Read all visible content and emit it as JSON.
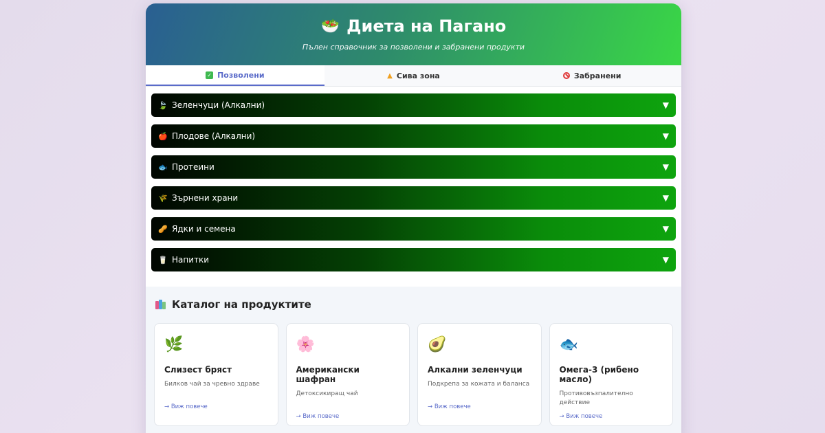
{
  "header": {
    "icon": "salad-bowl-icon",
    "title": "Диета на Пагано",
    "subtitle": "Пълен справочник за позволени и забранени продукти"
  },
  "tabs": [
    {
      "label": "Позволени",
      "icon": "checkmark-icon",
      "active": true
    },
    {
      "label": "Сива зона",
      "icon": "warning-icon",
      "active": false
    },
    {
      "label": "Забранени",
      "icon": "ban-icon",
      "active": false
    }
  ],
  "accordion": [
    {
      "label": "Зеленчуци (Алкални)",
      "icon": "leaf-icon"
    },
    {
      "label": "Плодове (Алкални)",
      "icon": "apple-icon"
    },
    {
      "label": "Протеини",
      "icon": "fish-icon"
    },
    {
      "label": "Зърнени храни",
      "icon": "grain-icon"
    },
    {
      "label": "Ядки и семена",
      "icon": "peanut-icon"
    },
    {
      "label": "Напитки",
      "icon": "cup-icon"
    }
  ],
  "catalog": {
    "title": "Каталог на продуктите",
    "icon": "books-icon",
    "products": [
      {
        "name": "Слизест бряст",
        "desc": "Билков чай за чревно здраве",
        "link": "→ Виж повече",
        "icon": "herb-icon"
      },
      {
        "name": "Американски шафран",
        "desc": "Детоксикиращ чай",
        "link": "→ Виж повече",
        "icon": "flower-icon"
      },
      {
        "name": "Алкални зеленчуци",
        "desc": "Подкрепа за кожата и баланса",
        "link": "→ Виж повече",
        "icon": "avocado-icon"
      },
      {
        "name": "Омега-3 (рибено масло)",
        "desc": "Противовъзпалително действие",
        "link": "→ Виж повече",
        "icon": "fish-icon"
      }
    ]
  },
  "colors": {
    "accent": "#5a6bc9",
    "header_start": "#2a5f92",
    "header_end": "#3ad746",
    "accordion_dark": "#010601",
    "accordion_green": "#0ea40e"
  }
}
